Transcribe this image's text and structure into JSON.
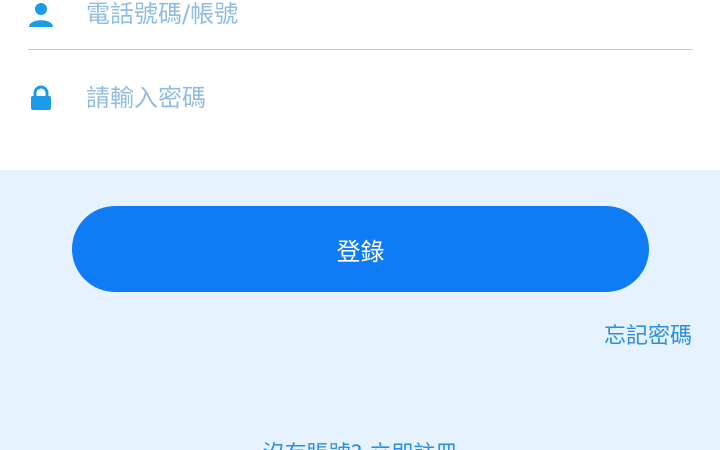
{
  "login_form": {
    "phone_field": {
      "icon": "user-icon",
      "placeholder": "電話號碼/帳號",
      "value": ""
    },
    "password_field": {
      "icon": "lock-icon",
      "placeholder": "請輸入密碼",
      "value": ""
    },
    "login_button_label": "登錄",
    "forgot_password_label": "忘記密碼",
    "register_prompt": "沒有賬號? 立即註冊"
  },
  "colors": {
    "primary": "#0f7bf5",
    "link": "#2a8fe0",
    "icon": "#1e9be6",
    "placeholder": "#8fbde3",
    "background": "#e6f2fd",
    "card": "#ffffff"
  }
}
